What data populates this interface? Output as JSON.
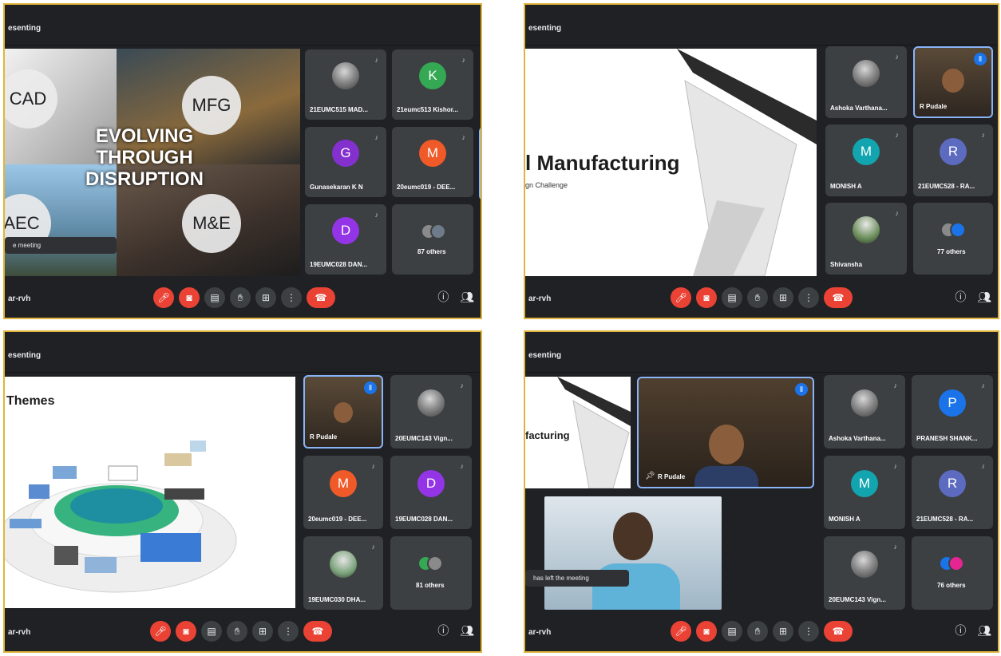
{
  "common": {
    "topbar_label": "esenting",
    "meeting_code": "ar-rvh",
    "others_label_a": "87 others",
    "others_label_b": "77 others",
    "others_label_c": "81 others",
    "others_label_d": "76 others",
    "colors": {
      "panel_bg": "#202124",
      "tile_bg": "#3c4043",
      "border": "#e0b43c",
      "red": "#ea4335",
      "blue": "#1a73e8"
    }
  },
  "panel1": {
    "slide": {
      "line1": "EVOLVING",
      "line2": "THROUGH",
      "line3": "DISRUPTION",
      "cad": "CAD",
      "mfg": "MFG",
      "aec": "AEC",
      "me": "M&E",
      "toast": "e meeting"
    },
    "tiles": [
      {
        "name": "21EUMC515 MAD...",
        "avatar": "photo"
      },
      {
        "name": "21eumc513 Kishor...",
        "letter": "K",
        "color": "#34a853"
      },
      {
        "name": "Gunasekaran K N",
        "letter": "G",
        "color": "#8430ce"
      },
      {
        "name": "20eumc019 - DEE...",
        "letter": "M",
        "color": "#f05a28"
      },
      {
        "name": "19EUMC028 DAN...",
        "letter": "D",
        "color": "#9334e6"
      }
    ]
  },
  "panel2": {
    "slide": {
      "title": "l Manufacturing",
      "subtitle": "gn Challenge"
    },
    "tiles": [
      {
        "name": "Ashoka Varthana...",
        "avatar": "photo"
      },
      {
        "name": "R Pudale",
        "avatar": "video"
      },
      {
        "name": "MONISH A",
        "letter": "M",
        "color": "#12a4af"
      },
      {
        "name": "21EUMC528 - RA...",
        "letter": "R",
        "color": "#5c6bc0"
      },
      {
        "name": "Shivansha",
        "avatar": "photo"
      }
    ]
  },
  "panel3": {
    "slide": {
      "title": "Themes"
    },
    "tiles": [
      {
        "name": "R Pudale",
        "avatar": "video"
      },
      {
        "name": "20EUMC143 Vign...",
        "avatar": "photo"
      },
      {
        "name": "20eumc019 - DEE...",
        "letter": "M",
        "color": "#f05a28"
      },
      {
        "name": "19EUMC028 DAN...",
        "letter": "D",
        "color": "#9334e6"
      },
      {
        "name": "19EUMC030 DHA...",
        "avatar": "photo"
      }
    ]
  },
  "panel4": {
    "slide": {
      "title": "facturing"
    },
    "presenter": {
      "name": "R Pudale"
    },
    "toast": "has left the meeting",
    "tiles": [
      {
        "name": "Ashoka Varthana...",
        "avatar": "photo"
      },
      {
        "name": "PRANESH SHANK...",
        "letter": "P",
        "color": "#1a73e8"
      },
      {
        "name": "MONISH A",
        "letter": "M",
        "color": "#12a4af"
      },
      {
        "name": "21EUMC528 - RA...",
        "letter": "R",
        "color": "#5c6bc0"
      },
      {
        "name": "20EUMC143 Vign...",
        "avatar": "photo"
      }
    ]
  }
}
